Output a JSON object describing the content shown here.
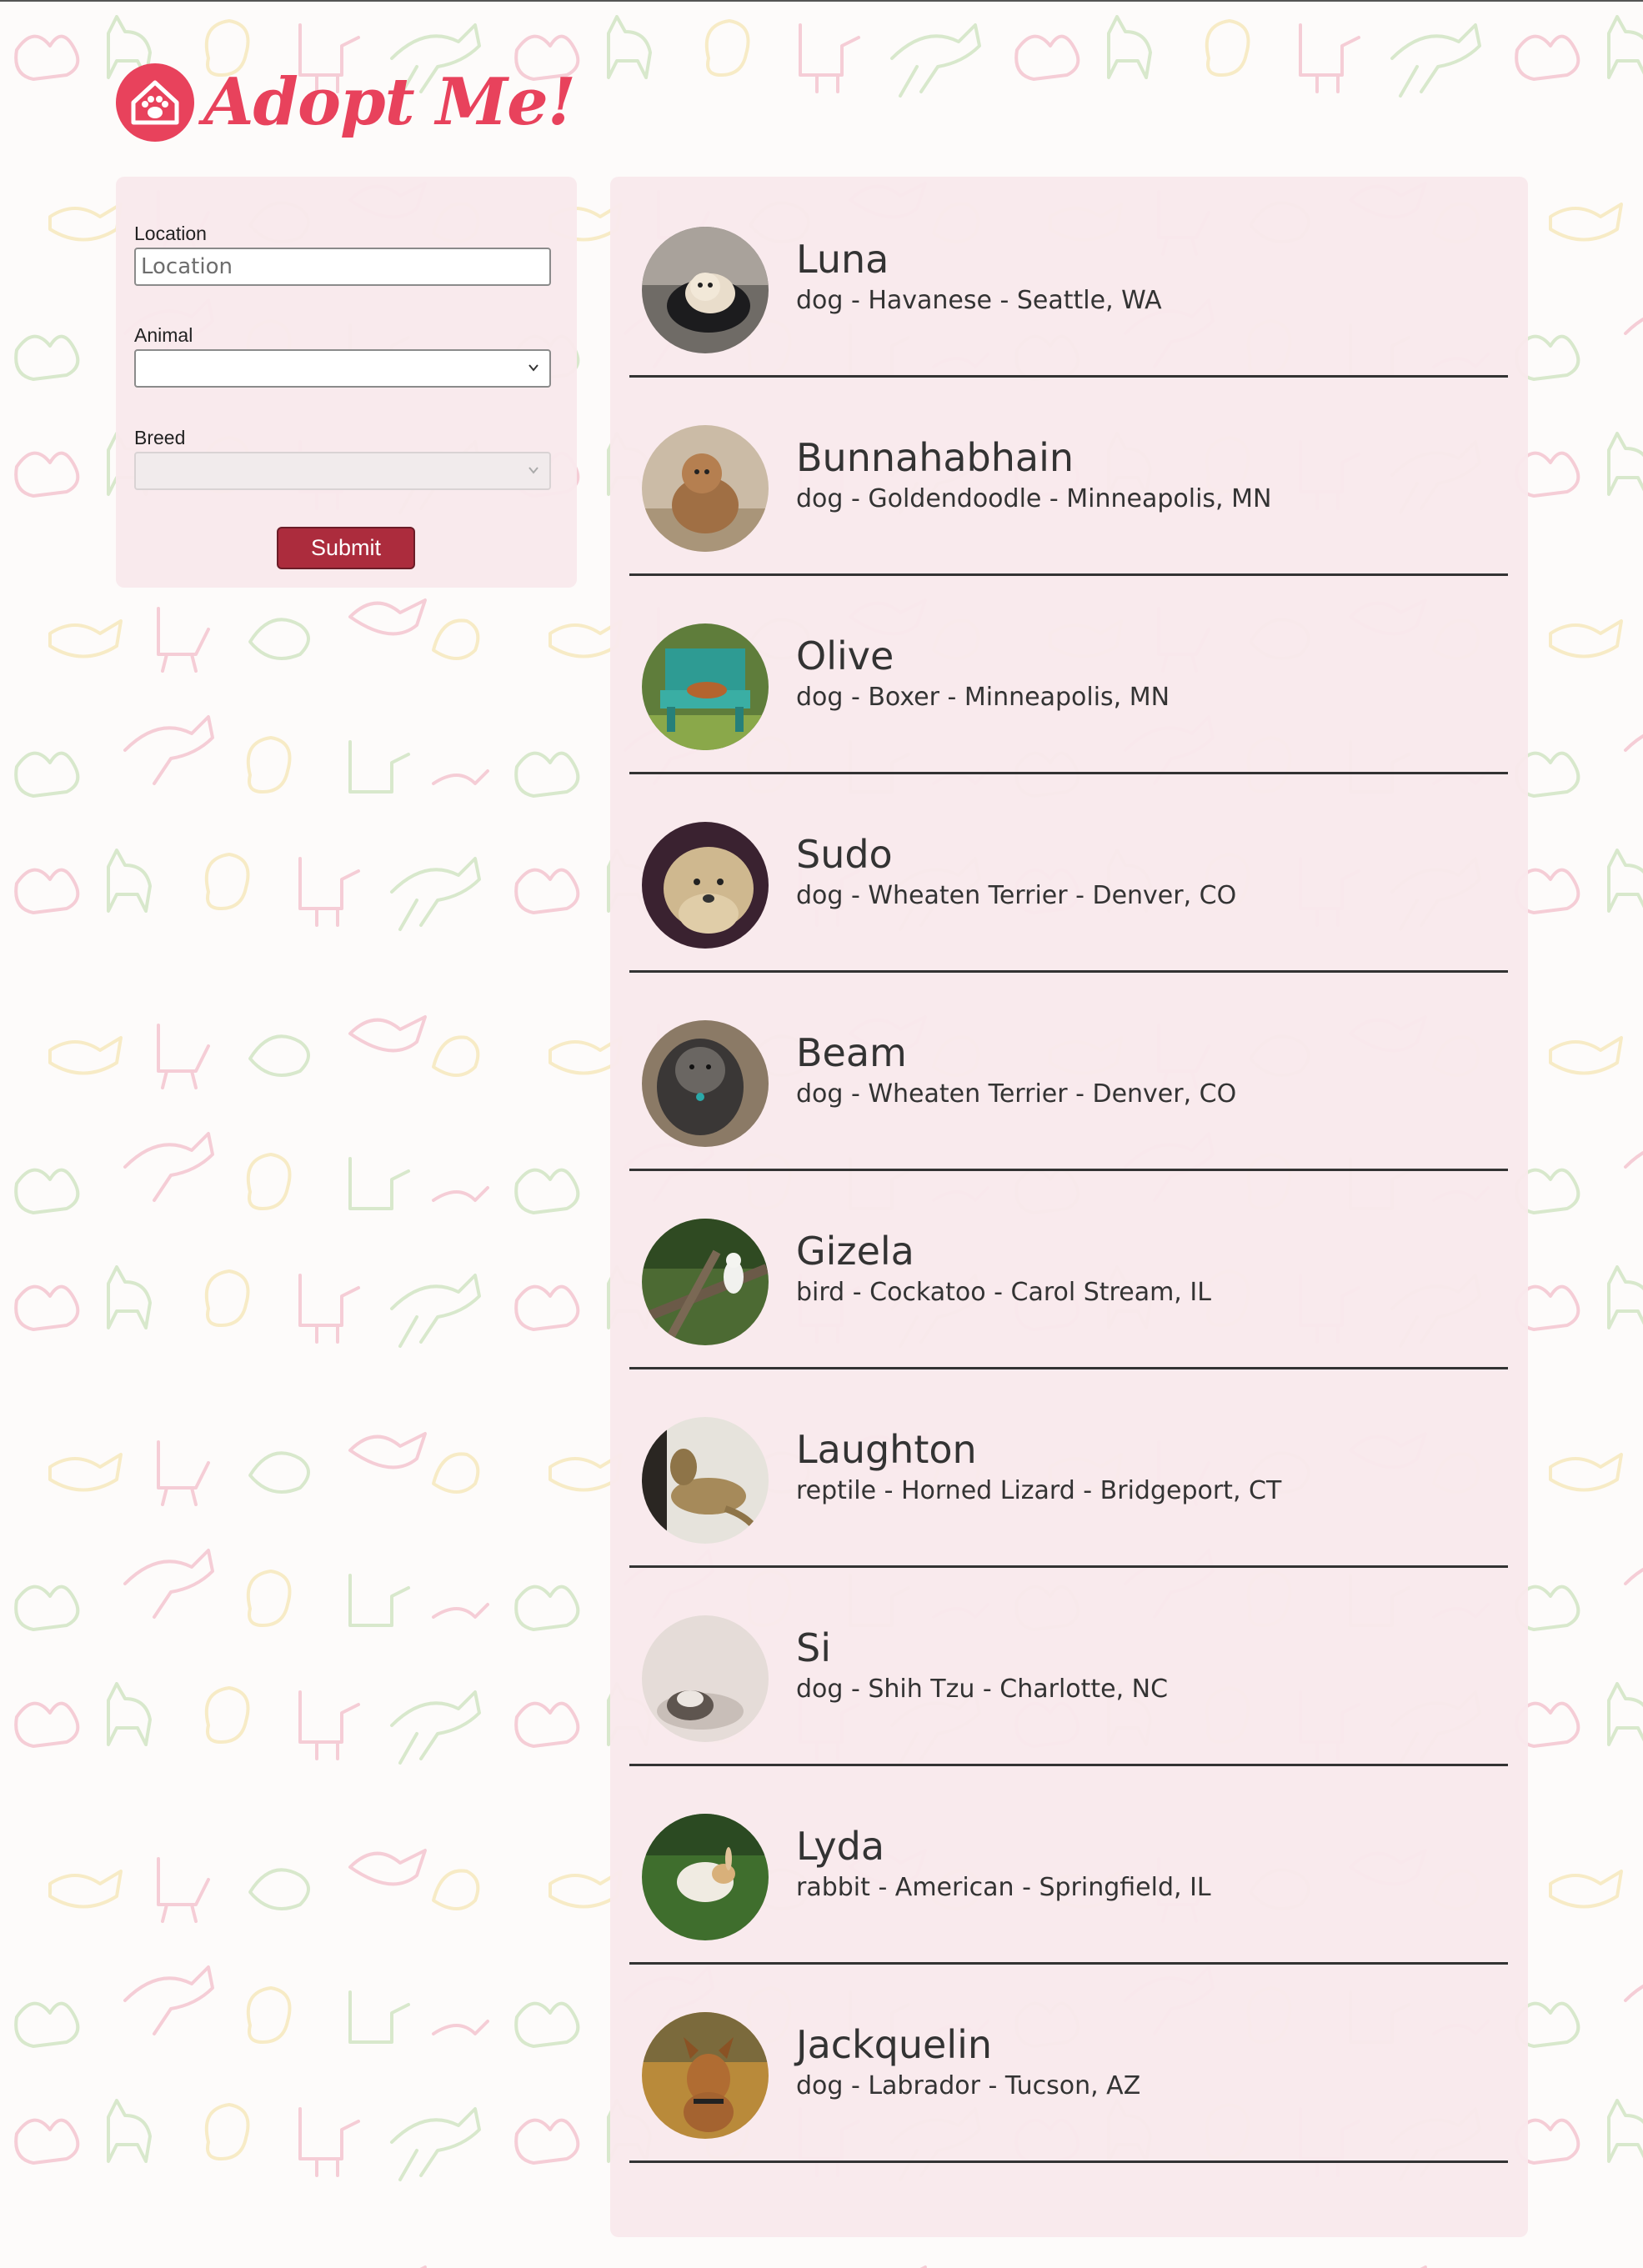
{
  "brand": {
    "logo_text": "Adopt Me!",
    "logo_color": "#e8425c"
  },
  "search": {
    "location_label": "Location",
    "location_placeholder": "Location",
    "location_value": "",
    "animal_label": "Animal",
    "animal_selected": "",
    "breed_label": "Breed",
    "breed_selected": "",
    "breed_disabled": true,
    "submit_label": "Submit",
    "submit_color": "#ac2c3d"
  },
  "pets": [
    {
      "name": "Luna",
      "description": "dog - Havanese - Seattle, WA",
      "photo_icon": "dog-photo"
    },
    {
      "name": "Bunnahabhain",
      "description": "dog - Goldendoodle - Minneapolis, MN",
      "photo_icon": "dog-photo"
    },
    {
      "name": "Olive",
      "description": "dog - Boxer - Minneapolis, MN",
      "photo_icon": "dog-photo"
    },
    {
      "name": "Sudo",
      "description": "dog - Wheaten Terrier - Denver, CO",
      "photo_icon": "dog-photo"
    },
    {
      "name": "Beam",
      "description": "dog - Wheaten Terrier - Denver, CO",
      "photo_icon": "dog-photo"
    },
    {
      "name": "Gizela",
      "description": "bird - Cockatoo - Carol Stream, IL",
      "photo_icon": "bird-photo"
    },
    {
      "name": "Laughton",
      "description": "reptile - Horned Lizard - Bridgeport, CT",
      "photo_icon": "lizard-photo"
    },
    {
      "name": "Si",
      "description": "dog - Shih Tzu - Charlotte, NC",
      "photo_icon": "dog-photo"
    },
    {
      "name": "Lyda",
      "description": "rabbit - American - Springfield, IL",
      "photo_icon": "rabbit-photo"
    },
    {
      "name": "Jackquelin",
      "description": "dog - Labrador - Tucson, AZ",
      "photo_icon": "dog-photo"
    }
  ]
}
